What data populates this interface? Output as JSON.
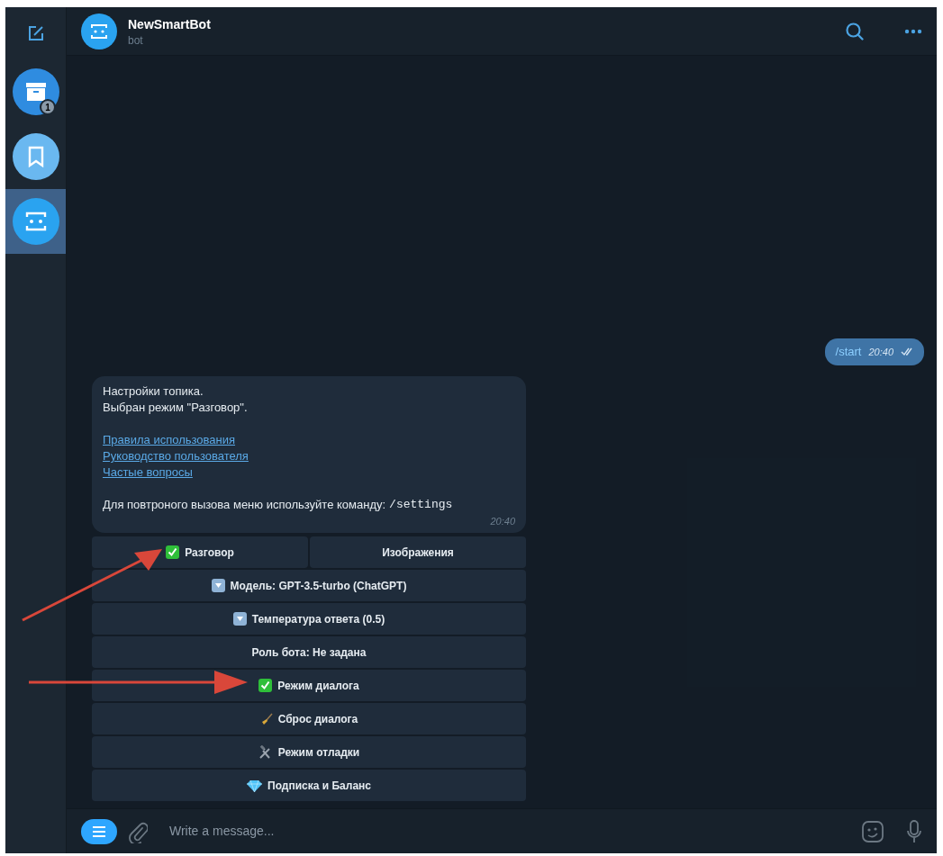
{
  "sidebar": {
    "items": [
      {
        "kind": "compose",
        "selected": false
      },
      {
        "kind": "archive",
        "selected": false,
        "badge": "1"
      },
      {
        "kind": "saved",
        "selected": false
      },
      {
        "kind": "bot",
        "selected": true
      }
    ]
  },
  "header": {
    "title": "NewSmartBot",
    "subtitle": "bot"
  },
  "messages": [
    {
      "kind": "outgoing",
      "text": "/start",
      "time": "20:40"
    },
    {
      "kind": "incoming",
      "lines": [
        "Настройки топика.",
        "Выбран режим \"Разговор\"."
      ],
      "links": [
        "Правила использования",
        "Руководство пользователя",
        "Частые вопросы"
      ],
      "footer": "Для повтроного вызова меню используйте команду:",
      "command": "/settings",
      "time": "20:40"
    }
  ],
  "keyboard": [
    [
      {
        "label": "Разговор",
        "kind": "check"
      },
      {
        "label": "Изображения",
        "kind": "plain"
      }
    ],
    [
      {
        "label": "Модель: GPT-3.5-turbo (ChatGPT)",
        "kind": "down"
      }
    ],
    [
      {
        "label": "Температура ответа (0.5)",
        "kind": "down"
      }
    ],
    [
      {
        "label": "Роль бота: Не задана",
        "kind": "plain"
      }
    ],
    [
      {
        "label": "Режим диалога",
        "kind": "check"
      }
    ],
    [
      {
        "label": "Сброс диалога",
        "kind": "broom"
      }
    ],
    [
      {
        "label": "Режим отладки",
        "kind": "tools"
      }
    ],
    [
      {
        "label": "Подписка и Баланс",
        "kind": "gem"
      }
    ]
  ],
  "composer": {
    "placeholder": "Write a message..."
  }
}
